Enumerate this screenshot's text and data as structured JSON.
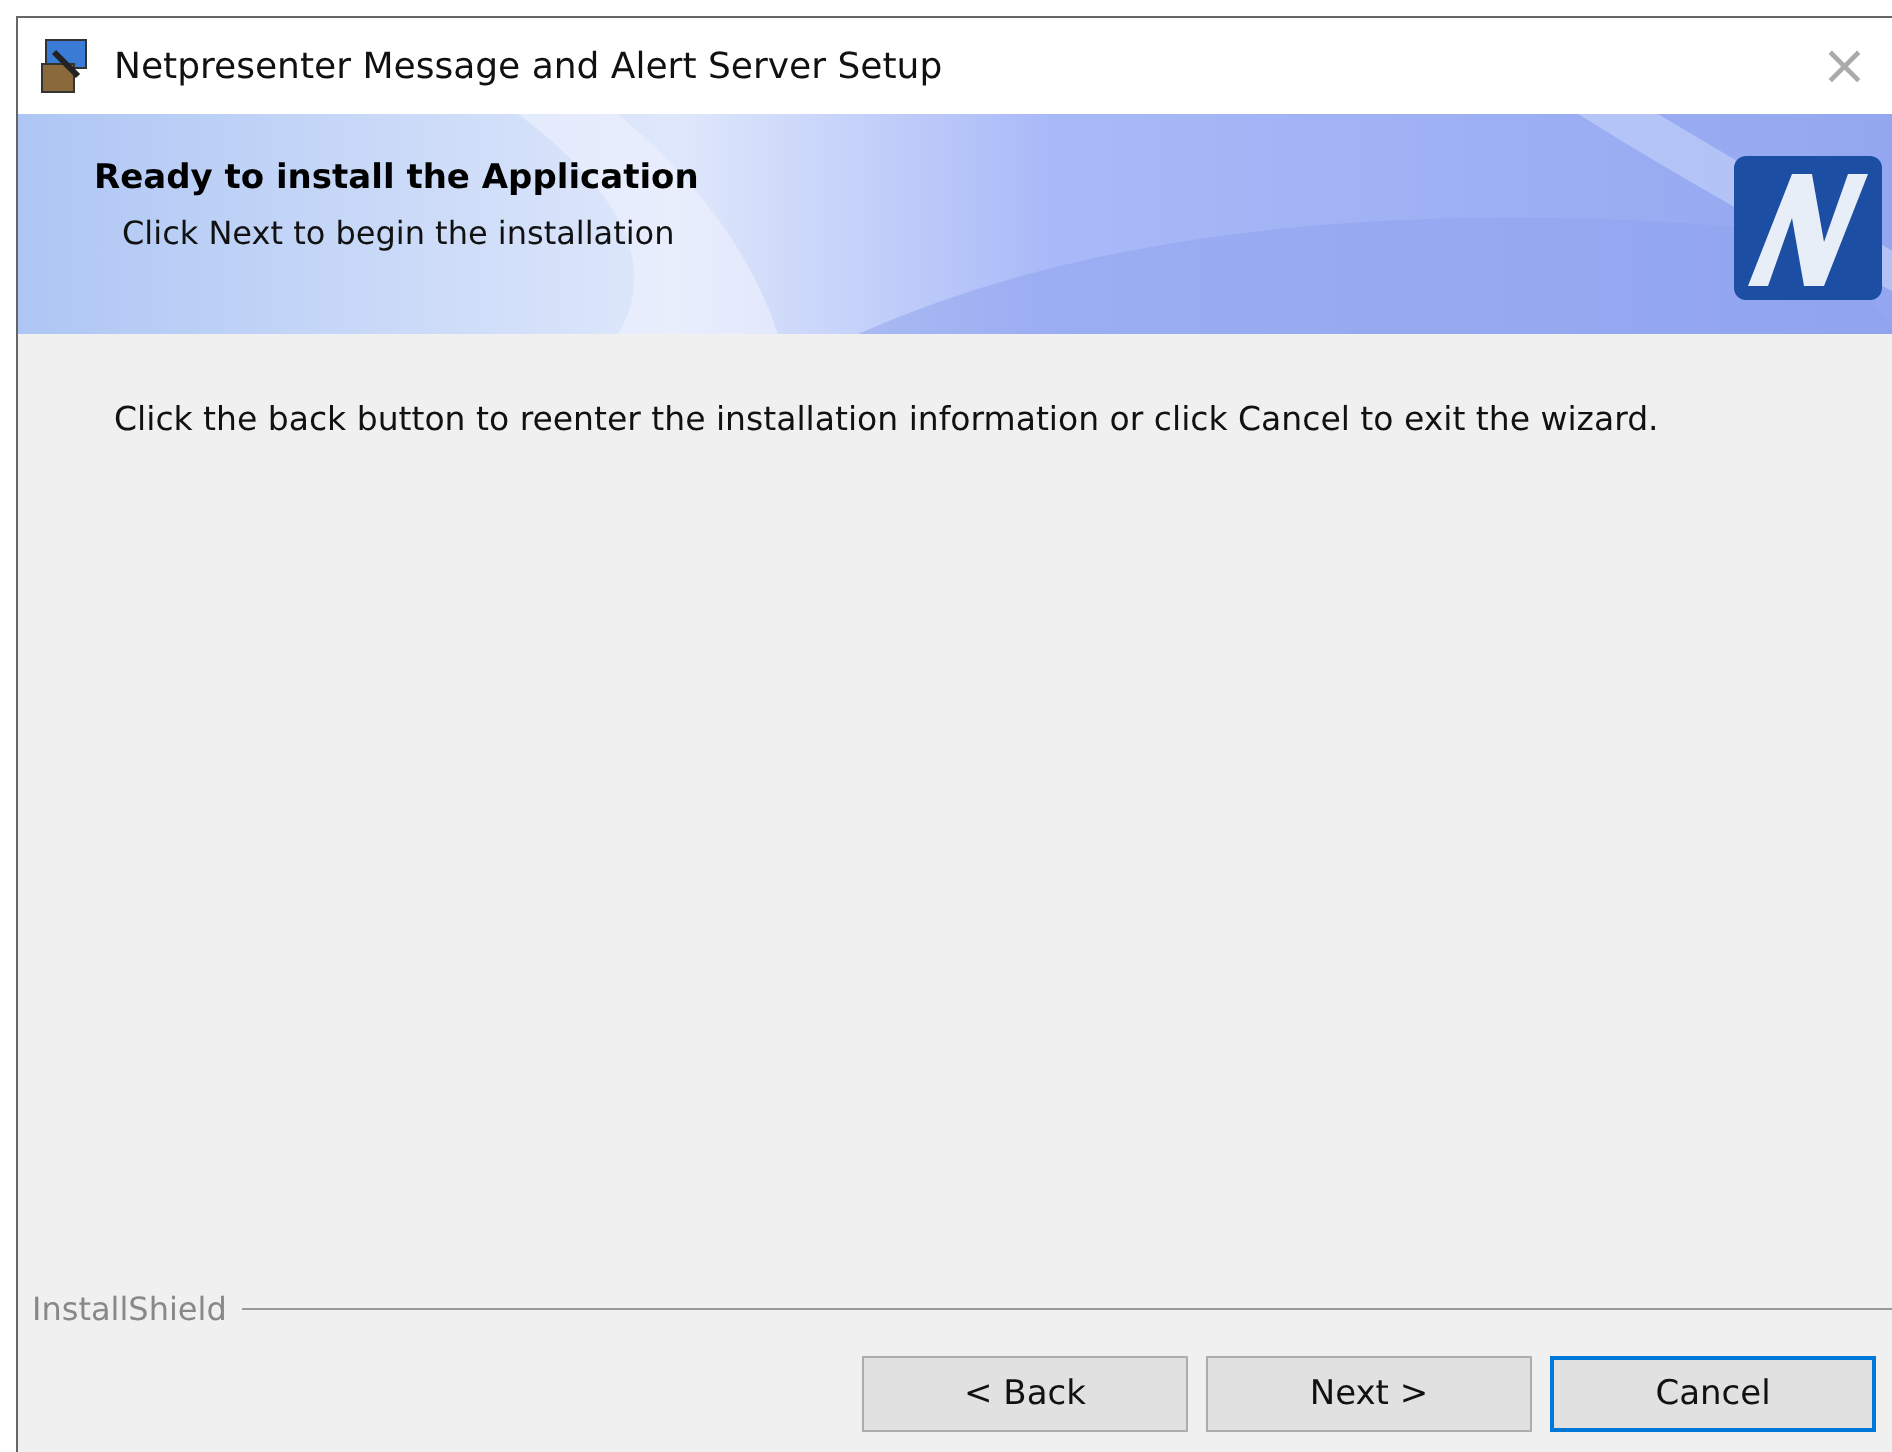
{
  "window": {
    "title": "Netpresenter Message and Alert Server Setup",
    "close": "×"
  },
  "banner": {
    "title": "Ready to install the Application",
    "subtitle": "Click Next to begin the installation"
  },
  "body": {
    "message": "Click the back button to reenter the installation information or click Cancel to exit the wizard."
  },
  "footer": {
    "brand": "InstallShield"
  },
  "buttons": [
    {
      "label": "< Back",
      "focused": false
    },
    {
      "label": "Next >",
      "focused": false
    },
    {
      "label": "Cancel",
      "focused": true
    }
  ]
}
